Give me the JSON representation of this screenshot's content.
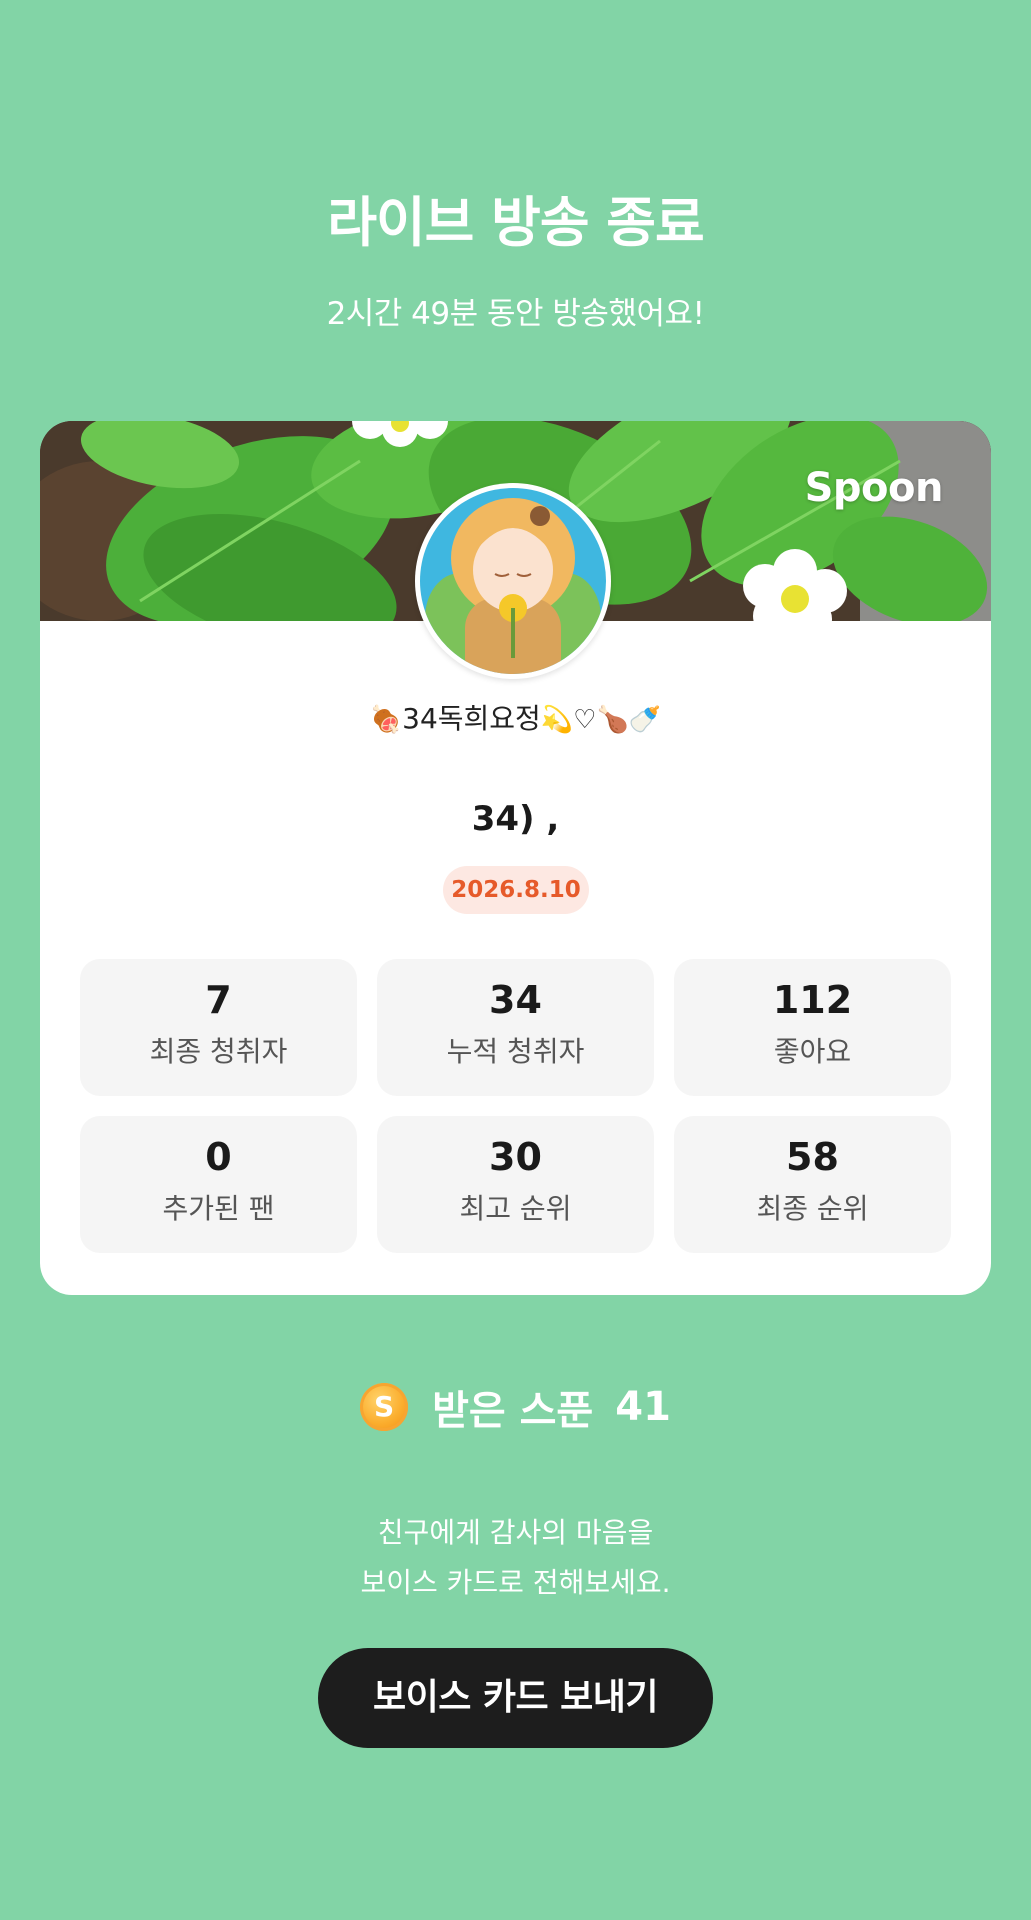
{
  "header": {
    "title": "라이브 방송 종료",
    "subtitle": "2시간 49분 동안 방송했어요!"
  },
  "card": {
    "brand": "Spoon",
    "nickname": "34독희요정",
    "nickname_emoji_left": "🍖",
    "nickname_emoji_right": "💫♡🍗🍼",
    "broadcast_title": "34) ,",
    "date": "2026.8.10",
    "stats": [
      {
        "value": "7",
        "label": "최종 청취자"
      },
      {
        "value": "34",
        "label": "누적 청취자"
      },
      {
        "value": "112",
        "label": "좋아요"
      },
      {
        "value": "0",
        "label": "추가된 팬"
      },
      {
        "value": "30",
        "label": "최고 순위"
      },
      {
        "value": "58",
        "label": "최종 순위"
      }
    ]
  },
  "spoons": {
    "icon_letter": "S",
    "label": "받은 스푼",
    "count": "41"
  },
  "message": {
    "line1": "친구에게 감사의 마음을",
    "line2": "보이스 카드로 전해보세요."
  },
  "button": {
    "label": "보이스 카드 보내기"
  },
  "colors": {
    "background": "#82d4a6",
    "date_badge_bg": "#fde8e2",
    "date_badge_text": "#e65a2a",
    "button_bg": "#1d1d1d"
  }
}
